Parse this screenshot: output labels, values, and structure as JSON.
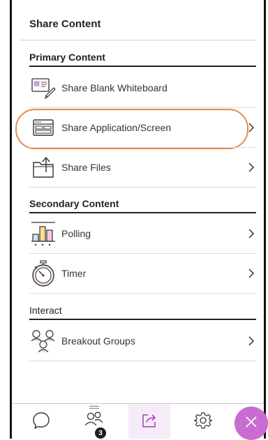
{
  "panel": {
    "title": "Share Content"
  },
  "sections": {
    "primary": {
      "heading": "Primary Content",
      "items": [
        {
          "label": "Share Blank Whiteboard",
          "icon": "whiteboard-icon",
          "has_chevron": false
        },
        {
          "label": "Share Application/Screen",
          "icon": "screen-share-icon",
          "has_chevron": true,
          "highlighted": true
        },
        {
          "label": "Share Files",
          "icon": "share-files-icon",
          "has_chevron": true
        }
      ]
    },
    "secondary": {
      "heading": "Secondary Content",
      "items": [
        {
          "label": "Polling",
          "icon": "polling-icon",
          "has_chevron": true
        },
        {
          "label": "Timer",
          "icon": "timer-icon",
          "has_chevron": true
        }
      ]
    },
    "interact": {
      "heading": "Interact",
      "items": [
        {
          "label": "Breakout Groups",
          "icon": "breakout-groups-icon",
          "has_chevron": true
        }
      ]
    }
  },
  "tabbar": {
    "tabs": [
      {
        "icon": "chat-icon"
      },
      {
        "icon": "attendees-icon",
        "badge": "3"
      },
      {
        "icon": "share-content-icon",
        "active": true
      },
      {
        "icon": "settings-icon"
      }
    ],
    "close_icon": "close-icon"
  },
  "colors": {
    "highlight": "#e9884e",
    "accent": "#c86cd2",
    "active_tab": "#a63cc0"
  }
}
